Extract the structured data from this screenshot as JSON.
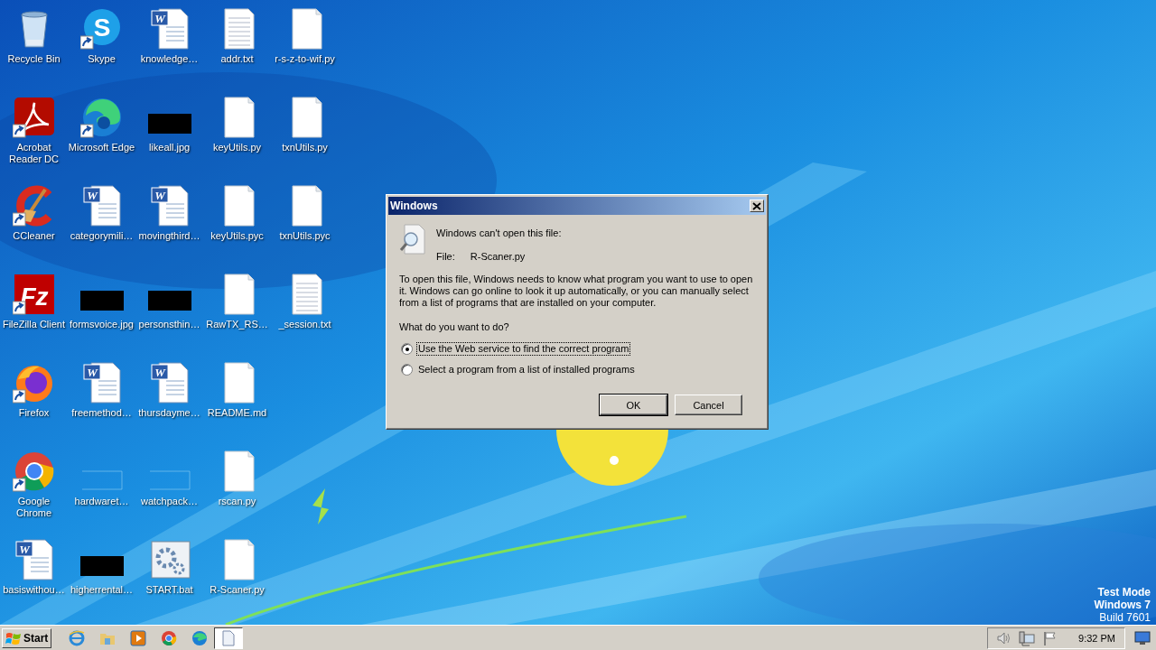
{
  "desktop_icons": [
    {
      "label": "Recycle Bin",
      "kind": "recycle",
      "shortcut": false
    },
    {
      "label": "Acrobat Reader DC",
      "kind": "acrobat",
      "shortcut": true
    },
    {
      "label": "CCleaner",
      "kind": "ccleaner",
      "shortcut": true
    },
    {
      "label": "FileZilla Client",
      "kind": "filezilla",
      "shortcut": true,
      "glyph": "Fz"
    },
    {
      "label": "Firefox",
      "kind": "firefox",
      "shortcut": true
    },
    {
      "label": "Google Chrome",
      "kind": "chrome",
      "shortcut": true
    },
    {
      "label": "basiswithou…",
      "kind": "word",
      "shortcut": false,
      "glyph": "W"
    },
    {
      "label": "Skype",
      "kind": "skype",
      "shortcut": true,
      "glyph": "S"
    },
    {
      "label": "Microsoft Edge",
      "kind": "edge",
      "shortcut": true
    },
    {
      "label": "categorymili…",
      "kind": "word",
      "shortcut": false,
      "glyph": "W"
    },
    {
      "label": "formsvoice.jpg",
      "kind": "redacted",
      "shortcut": false
    },
    {
      "label": "freemethod…",
      "kind": "word",
      "shortcut": false,
      "glyph": "W"
    },
    {
      "label": "hardwaret…",
      "kind": "faint",
      "shortcut": false
    },
    {
      "label": "higherrental…",
      "kind": "redacted",
      "shortcut": false
    },
    {
      "label": "knowledge…",
      "kind": "word",
      "shortcut": false,
      "glyph": "W"
    },
    {
      "label": "likeall.jpg",
      "kind": "redacted",
      "shortcut": false
    },
    {
      "label": "movingthird…",
      "kind": "word",
      "shortcut": false,
      "glyph": "W"
    },
    {
      "label": "personsthin…",
      "kind": "redacted",
      "shortcut": false
    },
    {
      "label": "thursdayme…",
      "kind": "word",
      "shortcut": false,
      "glyph": "W"
    },
    {
      "label": "watchpack…",
      "kind": "faint",
      "shortcut": false
    },
    {
      "label": "START.bat",
      "kind": "batch",
      "shortcut": false
    },
    {
      "label": "addr.txt",
      "kind": "text",
      "shortcut": false
    },
    {
      "label": "keyUtils.py",
      "kind": "blank",
      "shortcut": false
    },
    {
      "label": "keyUtils.pyc",
      "kind": "blank",
      "shortcut": false
    },
    {
      "label": "RawTX_RS…",
      "kind": "blank",
      "shortcut": false
    },
    {
      "label": "README.md",
      "kind": "blank",
      "shortcut": false
    },
    {
      "label": "rscan.py",
      "kind": "blank",
      "shortcut": false
    },
    {
      "label": "R-Scaner.py",
      "kind": "blank",
      "shortcut": false
    },
    {
      "label": "r-s-z-to-wif.py",
      "kind": "blank",
      "shortcut": false
    },
    {
      "label": "txnUtils.py",
      "kind": "blank",
      "shortcut": false
    },
    {
      "label": "txnUtils.pyc",
      "kind": "blank",
      "shortcut": false
    },
    {
      "label": "_session.txt",
      "kind": "text",
      "shortcut": false
    }
  ],
  "dialog": {
    "title": "Windows",
    "heading": "Windows can't open this file:",
    "file_label": "File:",
    "file_name": "R-Scaner.py",
    "message": "To open this file, Windows needs to know what program you want to use to open it. Windows can go online to look it up automatically, or you can manually select from a list of programs that are installed on your computer.",
    "question": "What do you want to do?",
    "options": [
      {
        "label": "Use the Web service to find the correct program",
        "selected": true,
        "focused": true
      },
      {
        "label": "Select a program from a list of installed programs",
        "selected": false,
        "focused": false
      }
    ],
    "buttons": [
      {
        "label": "OK",
        "default": true
      },
      {
        "label": "Cancel",
        "default": false
      }
    ]
  },
  "desktop_watermark": [
    "Test Mode",
    "Windows 7",
    "Build 7601"
  ],
  "taskbar": {
    "start_label": "Start",
    "pinned": [
      {
        "kind": "ie"
      },
      {
        "kind": "folder"
      },
      {
        "kind": "media"
      },
      {
        "kind": "chrome"
      },
      {
        "kind": "edge"
      }
    ],
    "tasks": [
      {
        "kind": "document",
        "active": true
      }
    ],
    "tray": [
      {
        "kind": "speaker"
      },
      {
        "kind": "network"
      },
      {
        "kind": "flag"
      }
    ],
    "clock": "9:32 PM"
  }
}
